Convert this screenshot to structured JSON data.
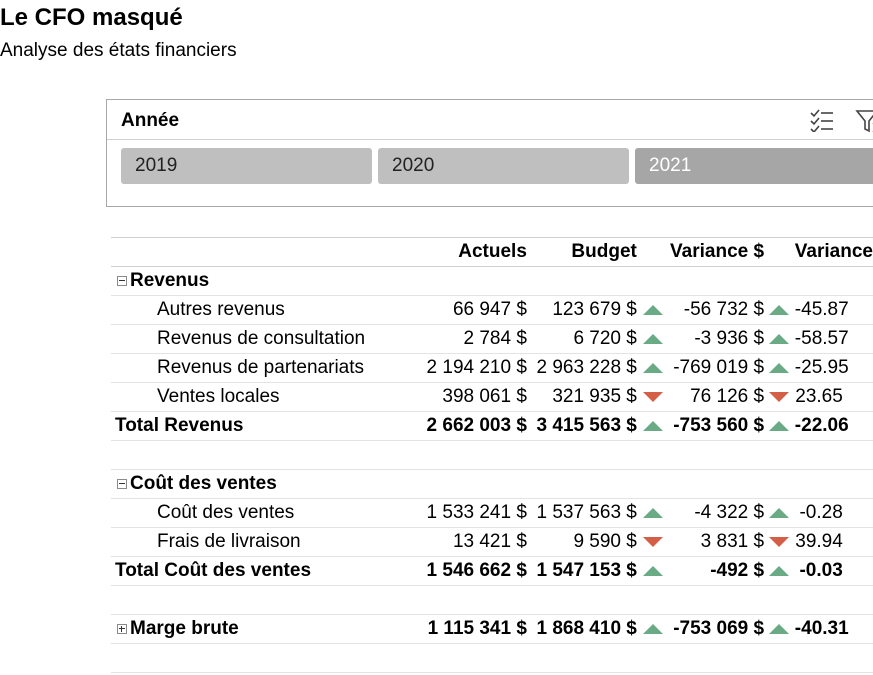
{
  "report": {
    "title": "Le CFO masqué",
    "subtitle": "Analyse des états financiers"
  },
  "slicer": {
    "header": "Année",
    "icons": [
      "multi-select-icon",
      "clear-filter-icon"
    ],
    "items": [
      {
        "label": "2019",
        "selected": false
      },
      {
        "label": "2020",
        "selected": false
      },
      {
        "label": "2021",
        "selected": true
      }
    ]
  },
  "colors": {
    "up_arrow": "#6aab86",
    "down_arrow": "#d45f47",
    "slicer_btn": "#bfbfbf",
    "slicer_btn_active": "#a6a6a6"
  },
  "table": {
    "headers": {
      "actuals": "Actuels",
      "budget": "Budget",
      "variance_amt": "Variance $",
      "variance_pct": "Variance"
    },
    "revenus": {
      "label": "Revenus",
      "rows": [
        {
          "label": "Autres revenus",
          "actuals": "66 947 $",
          "budget": "123 679 $",
          "arrow": "up",
          "variance": "-56 732 $",
          "arrow2": "up",
          "pct": "-45.87"
        },
        {
          "label": "Revenus de consultation",
          "actuals": "2 784 $",
          "budget": "6 720 $",
          "arrow": "up",
          "variance": "-3 936 $",
          "arrow2": "up",
          "pct": "-58.57"
        },
        {
          "label": "Revenus de partenariats",
          "actuals": "2 194 210 $",
          "budget": "2 963 228 $",
          "arrow": "up",
          "variance": "-769 019 $",
          "arrow2": "up",
          "pct": "-25.95"
        },
        {
          "label": "Ventes locales",
          "actuals": "398 061 $",
          "budget": "321 935 $",
          "arrow": "down",
          "variance": "76 126 $",
          "arrow2": "down",
          "pct": "23.65"
        }
      ],
      "total": {
        "label": "Total Revenus",
        "actuals": "2 662 003 $",
        "budget": "3 415 563 $",
        "arrow": "up",
        "variance": "-753 560 $",
        "arrow2": "up",
        "pct": "-22.06"
      }
    },
    "cout": {
      "label": "Coût des ventes",
      "rows": [
        {
          "label": "Coût des ventes",
          "actuals": "1 533 241 $",
          "budget": "1 537 563 $",
          "arrow": "up",
          "variance": "-4 322 $",
          "arrow2": "up",
          "pct": "-0.28"
        },
        {
          "label": "Frais de livraison",
          "actuals": "13 421 $",
          "budget": "9 590 $",
          "arrow": "down",
          "variance": "3 831 $",
          "arrow2": "down",
          "pct": "39.94"
        }
      ],
      "total": {
        "label": "Total Coût des ventes",
        "actuals": "1 546 662 $",
        "budget": "1 547 153 $",
        "arrow": "up",
        "variance": "-492 $",
        "arrow2": "up",
        "pct": "-0.03"
      }
    },
    "marge": {
      "label": "Marge brute",
      "actuals": "1 115 341 $",
      "budget": "1 868 410 $",
      "arrow": "up",
      "variance": "-753 069 $",
      "arrow2": "up",
      "pct": "-40.31"
    }
  }
}
